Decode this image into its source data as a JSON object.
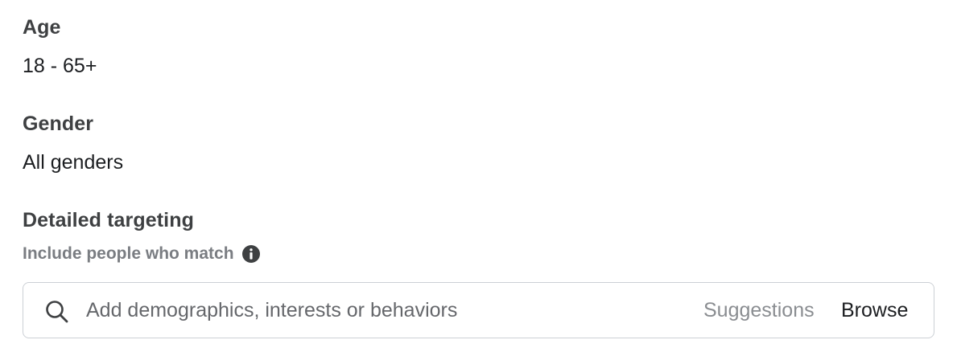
{
  "age": {
    "heading": "Age",
    "value": "18 - 65+"
  },
  "gender": {
    "heading": "Gender",
    "value": "All genders"
  },
  "detailed_targeting": {
    "heading": "Detailed targeting",
    "include_label": "Include people who match",
    "info_icon": "info-circle-icon",
    "search": {
      "icon": "search-icon",
      "value": "",
      "placeholder": "Add demographics, interests or behaviors"
    },
    "suggestions_label": "Suggestions",
    "browse_label": "Browse"
  }
}
